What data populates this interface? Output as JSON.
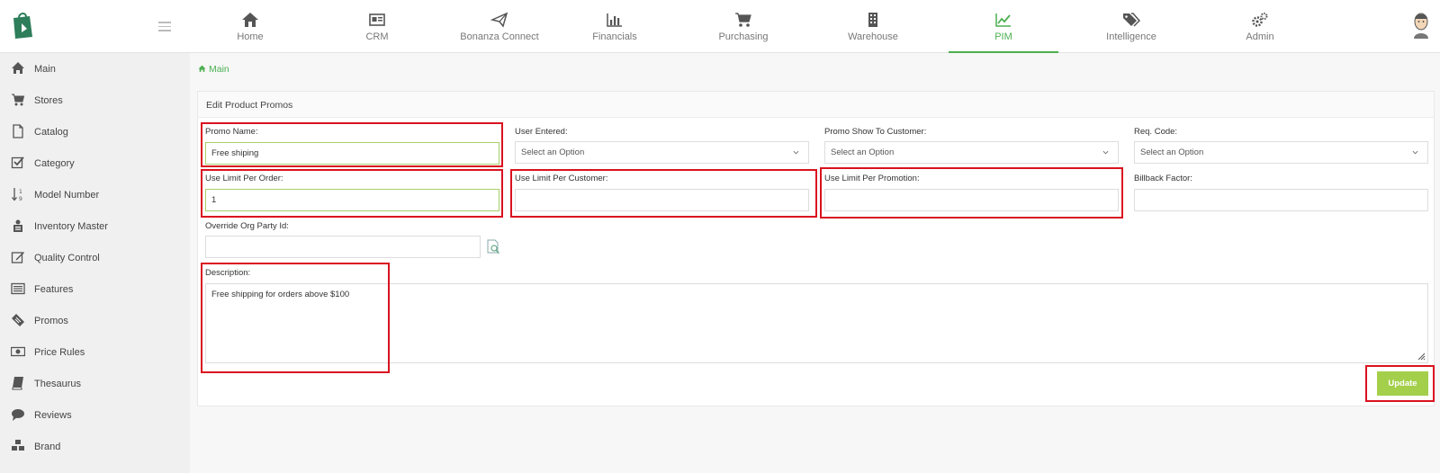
{
  "nav": [
    {
      "label": "Home",
      "icon": "home-icon"
    },
    {
      "label": "CRM",
      "icon": "id-card-icon"
    },
    {
      "label": "Bonanza Connect",
      "icon": "paper-plane-icon"
    },
    {
      "label": "Financials",
      "icon": "bar-chart-icon"
    },
    {
      "label": "Purchasing",
      "icon": "cart-icon"
    },
    {
      "label": "Warehouse",
      "icon": "building-icon"
    },
    {
      "label": "PIM",
      "icon": "line-chart-icon",
      "active": true
    },
    {
      "label": "Intelligence",
      "icon": "tags-icon"
    },
    {
      "label": "Admin",
      "icon": "gears-icon"
    }
  ],
  "sidebar": [
    {
      "label": "Main",
      "icon": "home-icon"
    },
    {
      "label": "Stores",
      "icon": "cart-icon"
    },
    {
      "label": "Catalog",
      "icon": "file-icon"
    },
    {
      "label": "Category",
      "icon": "check-square-icon"
    },
    {
      "label": "Model Number",
      "icon": "sort-numeric-icon"
    },
    {
      "label": "Inventory Master",
      "icon": "archive-user-icon"
    },
    {
      "label": "Quality Control",
      "icon": "edit-icon"
    },
    {
      "label": "Features",
      "icon": "list-alt-icon"
    },
    {
      "label": "Promos",
      "icon": "tickets-icon"
    },
    {
      "label": "Price Rules",
      "icon": "money-icon"
    },
    {
      "label": "Thesaurus",
      "icon": "book-icon"
    },
    {
      "label": "Reviews",
      "icon": "comment-icon"
    },
    {
      "label": "Brand",
      "icon": "cubes-icon"
    }
  ],
  "breadcrumb": {
    "label": "Main"
  },
  "panel": {
    "title": "Edit Product Promos"
  },
  "form": {
    "promo_name": {
      "label": "Promo Name:",
      "value": "Free shiping"
    },
    "user_entered": {
      "label": "User Entered:",
      "value": "Select an Option"
    },
    "promo_show": {
      "label": "Promo Show To Customer:",
      "value": "Select an Option"
    },
    "req_code": {
      "label": "Req. Code:",
      "value": "Select an Option"
    },
    "use_limit_order": {
      "label": "Use Limit Per Order:",
      "value": "1"
    },
    "use_limit_customer": {
      "label": "Use Limit Per Customer:",
      "value": ""
    },
    "use_limit_promotion": {
      "label": "Use Limit Per Promotion:",
      "value": ""
    },
    "billback_factor": {
      "label": "Billback Factor:",
      "value": ""
    },
    "override_org": {
      "label": "Override Org Party Id:",
      "value": ""
    },
    "description": {
      "label": "Description:",
      "value": "Free shipping for orders above  $100"
    }
  },
  "actions": {
    "update_label": "Update"
  },
  "colors": {
    "accent": "#4caf50",
    "button": "#a4cf4b",
    "highlight": "#d9121f"
  }
}
